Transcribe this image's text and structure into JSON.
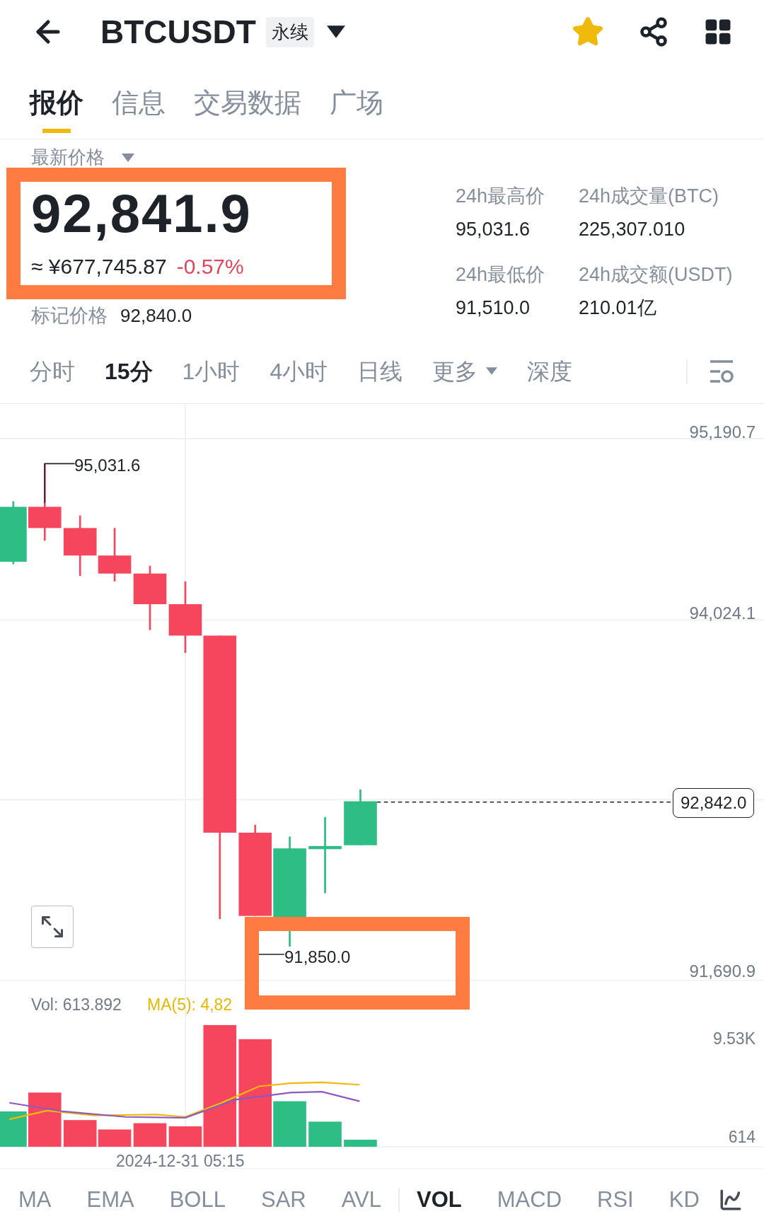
{
  "header": {
    "symbol": "BTCUSDT",
    "badge": "永续",
    "favorite": true
  },
  "tabs": [
    {
      "label": "报价",
      "selected": true
    },
    {
      "label": "信息",
      "selected": false
    },
    {
      "label": "交易数据",
      "selected": false
    },
    {
      "label": "广场",
      "selected": false
    }
  ],
  "price": {
    "label": "最新价格",
    "last": "92,841.9",
    "converted": "≈ ¥677,745.87",
    "change": "-0.57%",
    "mark_label": "标记价格",
    "mark_value": "92,840.0"
  },
  "stats": [
    {
      "label": "24h最高价",
      "value": "95,031.6"
    },
    {
      "label": "24h成交量(BTC)",
      "value": "225,307.010"
    },
    {
      "label": "24h最低价",
      "value": "91,510.0"
    },
    {
      "label": "24h成交额(USDT)",
      "value": "210.01亿"
    }
  ],
  "intervals": [
    {
      "label": "分时",
      "selected": false,
      "kind": "tab"
    },
    {
      "label": "15分",
      "selected": true,
      "kind": "tab"
    },
    {
      "label": "1小时",
      "selected": false,
      "kind": "tab"
    },
    {
      "label": "4小时",
      "selected": false,
      "kind": "tab"
    },
    {
      "label": "日线",
      "selected": false,
      "kind": "tab"
    },
    {
      "label": "更多",
      "selected": false,
      "kind": "dropdown"
    },
    {
      "label": "深度",
      "selected": false,
      "kind": "tab"
    }
  ],
  "chart": {
    "y_labels": [
      "95,190.7",
      "94,024.1",
      "91,690.9"
    ],
    "high_marker": "95,031.6",
    "low_marker": "91,850.0",
    "last_price": "92,842.0"
  },
  "volume": {
    "vol": "Vol: 613.892",
    "ma5": "MA(5): 4,82",
    "y_labels": [
      "9.53K",
      "614"
    ],
    "time": "2024-12-31 05:15"
  },
  "main_indicators": [
    {
      "label": "MA",
      "selected": false
    },
    {
      "label": "EMA",
      "selected": false
    },
    {
      "label": "BOLL",
      "selected": false
    },
    {
      "label": "SAR",
      "selected": false
    },
    {
      "label": "AVL",
      "selected": false
    }
  ],
  "sub_indicators": [
    {
      "label": "VOL",
      "selected": true
    },
    {
      "label": "MACD",
      "selected": false
    },
    {
      "label": "RSI",
      "selected": false
    },
    {
      "label": "KD",
      "selected": false
    }
  ]
}
